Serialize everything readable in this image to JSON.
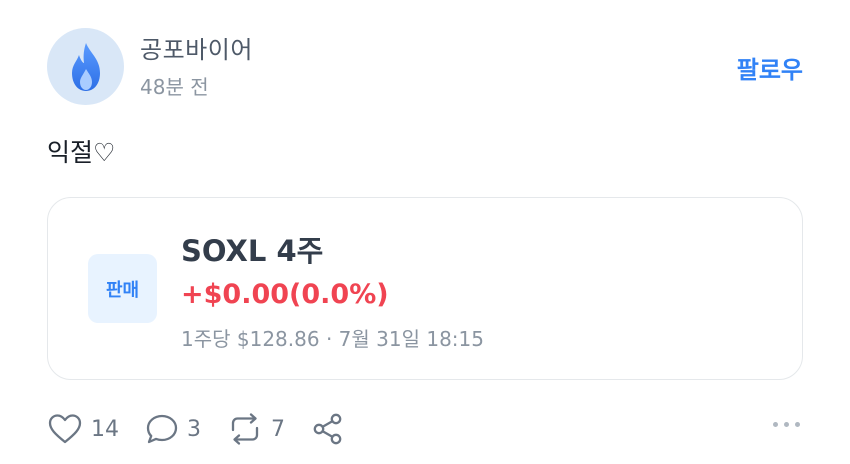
{
  "author": {
    "name": "공포바이어",
    "time": "48분 전",
    "avatar_icon": "fire-icon",
    "avatar_color": "#3d7ef0"
  },
  "follow_label": "팔로우",
  "content": "익절♡",
  "trade_card": {
    "badge": "판매",
    "title": "SOXL 4주",
    "change": "+$0.00(0.0%)",
    "detail": "1주당 $128.86 · 7월 31일 18:15",
    "change_color": "#f04452",
    "accent": "#3182f6"
  },
  "actions": {
    "like": {
      "icon": "heart-icon",
      "count": "14"
    },
    "comment": {
      "icon": "comment-icon",
      "count": "3"
    },
    "repost": {
      "icon": "repost-icon",
      "count": "7"
    },
    "share": {
      "icon": "share-icon"
    },
    "more": {
      "icon": "more-icon"
    }
  }
}
